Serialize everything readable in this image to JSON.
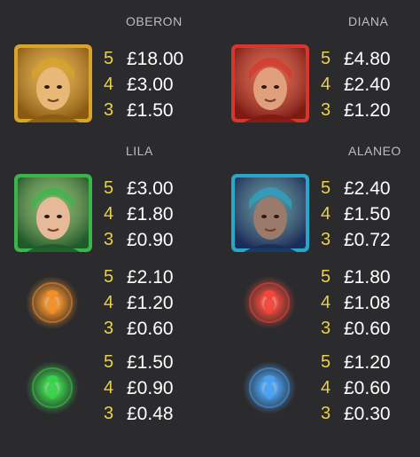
{
  "symbols": [
    {
      "name": "OBERON",
      "kind": "portrait",
      "icon": "oberon-portrait",
      "frame": "#d8a52a",
      "bg": "#8a5a12",
      "skin": "#e8b877",
      "pays": [
        {
          "count": "5",
          "amount": "£18.00"
        },
        {
          "count": "4",
          "amount": "£3.00"
        },
        {
          "count": "3",
          "amount": "£1.50"
        }
      ]
    },
    {
      "name": "DIANA",
      "kind": "portrait",
      "icon": "diana-portrait",
      "frame": "#d5372c",
      "bg": "#7e1a14",
      "skin": "#e0a07d",
      "pays": [
        {
          "count": "5",
          "amount": "£4.80"
        },
        {
          "count": "4",
          "amount": "£2.40"
        },
        {
          "count": "3",
          "amount": "£1.20"
        }
      ]
    },
    {
      "name": "LILA",
      "kind": "portrait",
      "icon": "lila-portrait",
      "frame": "#39b54a",
      "bg": "#1f5a29",
      "skin": "#e6b999",
      "pays": [
        {
          "count": "5",
          "amount": "£3.00"
        },
        {
          "count": "4",
          "amount": "£1.80"
        },
        {
          "count": "3",
          "amount": "£0.90"
        }
      ]
    },
    {
      "name": "ALANEO",
      "kind": "portrait",
      "icon": "alaneo-portrait",
      "frame": "#2aa7c8",
      "bg": "#1a2d5a",
      "skin": "#9a7a6a",
      "pays": [
        {
          "count": "5",
          "amount": "£2.40"
        },
        {
          "count": "4",
          "amount": "£1.50"
        },
        {
          "count": "3",
          "amount": "£0.72"
        }
      ]
    },
    {
      "name": "",
      "kind": "orb",
      "icon": "orange-fairy-orb-icon",
      "glow": "#f0902a",
      "pays": [
        {
          "count": "5",
          "amount": "£2.10"
        },
        {
          "count": "4",
          "amount": "£1.20"
        },
        {
          "count": "3",
          "amount": "£0.60"
        }
      ]
    },
    {
      "name": "",
      "kind": "orb",
      "icon": "red-fairy-orb-icon",
      "glow": "#f0483a",
      "pays": [
        {
          "count": "5",
          "amount": "£1.80"
        },
        {
          "count": "4",
          "amount": "£1.08"
        },
        {
          "count": "3",
          "amount": "£0.60"
        }
      ]
    },
    {
      "name": "",
      "kind": "orb",
      "icon": "green-fairy-orb-icon",
      "glow": "#3ad24a",
      "pays": [
        {
          "count": "5",
          "amount": "£1.50"
        },
        {
          "count": "4",
          "amount": "£0.90"
        },
        {
          "count": "3",
          "amount": "£0.48"
        }
      ]
    },
    {
      "name": "",
      "kind": "orb",
      "icon": "blue-fairy-orb-icon",
      "glow": "#4aa0f0",
      "pays": [
        {
          "count": "5",
          "amount": "£1.20"
        },
        {
          "count": "4",
          "amount": "£0.60"
        },
        {
          "count": "3",
          "amount": "£0.30"
        }
      ]
    }
  ]
}
